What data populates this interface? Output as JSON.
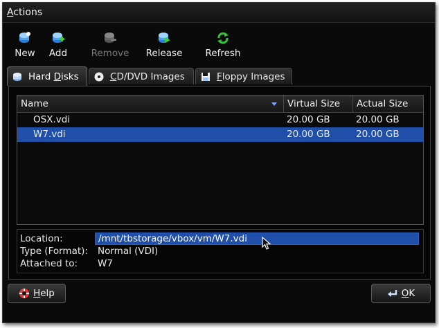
{
  "menubar": {
    "actions_label": "Actions",
    "actions_mnemonic": "A",
    "actions_rest": "ctions"
  },
  "toolbar": {
    "new_label": "New",
    "add_label": "Add",
    "remove_label": "Remove",
    "release_label": "Release",
    "refresh_label": "Refresh"
  },
  "tabs": [
    {
      "pre": "Hard ",
      "mn": "D",
      "post": "isks",
      "icon": "hard-disk-icon",
      "active": true
    },
    {
      "pre": "",
      "mn": "C",
      "post": "D/DVD Images",
      "icon": "cd-icon",
      "active": false
    },
    {
      "pre": "",
      "mn": "F",
      "post": "loppy Images",
      "icon": "floppy-icon",
      "active": false
    }
  ],
  "table": {
    "columns": [
      "Name",
      "Virtual Size",
      "Actual Size"
    ],
    "rows": [
      {
        "name": "OSX.vdi",
        "virtual_size": "20.00 GB",
        "actual_size": "20.00 GB",
        "selected": false
      },
      {
        "name": "W7.vdi",
        "virtual_size": "20.00 GB",
        "actual_size": "20.00 GB",
        "selected": true
      }
    ]
  },
  "details": {
    "location_label": "Location:",
    "location_value": "/mnt/tbstorage/vbox/vm/W7.vdi",
    "type_label": "Type (Format):",
    "type_value": "Normal (VDI)",
    "attached_label": "Attached to:",
    "attached_value": "W7"
  },
  "buttons": {
    "help_mn": "H",
    "help_rest": "elp",
    "ok_mn": "O",
    "ok_rest": "K"
  },
  "colors": {
    "selection": "#1f4fa8",
    "background": "#0a0a0a"
  }
}
